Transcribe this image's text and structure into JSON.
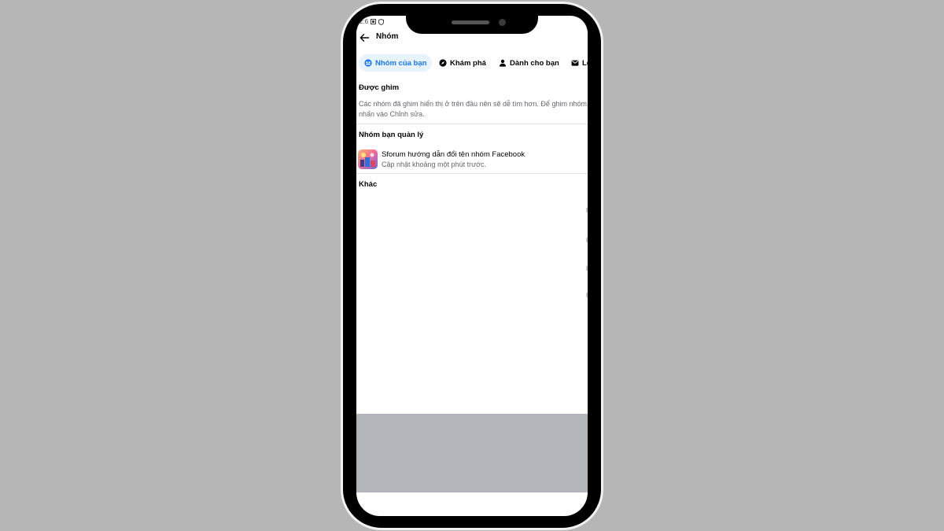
{
  "status_bar": {
    "time": "2:6",
    "icons": [
      "sim-icon",
      "shield-icon"
    ]
  },
  "header": {
    "title": "Nhóm",
    "back_icon": "back-arrow-icon"
  },
  "tabs": [
    {
      "label": "Nhóm của bạn",
      "icon": "groups-icon",
      "active": true
    },
    {
      "label": "Khám phá",
      "icon": "compass-icon",
      "active": false
    },
    {
      "label": "Dành cho bạn",
      "icon": "person-icon",
      "active": false
    },
    {
      "label": "Lờ",
      "icon": "invite-icon",
      "active": false
    }
  ],
  "pinned": {
    "title": "Được ghim",
    "description": "Các nhóm đã ghim hiển thị ở trên đầu nên sẽ dễ tìm hơn. Để ghim nhóm, nhấn vào Chỉnh sửa."
  },
  "managed": {
    "title": "Nhóm bạn quản lý",
    "groups": [
      {
        "name": "Sforum hướng dẫn đổi tên nhóm Facebook",
        "meta": "Cập nhật khoảng một phút trước."
      }
    ]
  },
  "other": {
    "title": "Khác"
  },
  "colors": {
    "accent": "#1877f2",
    "accent_bg": "#e7f3ff",
    "page_bg": "#b6b6b6",
    "sheet_grey": "#b2b5b9"
  }
}
